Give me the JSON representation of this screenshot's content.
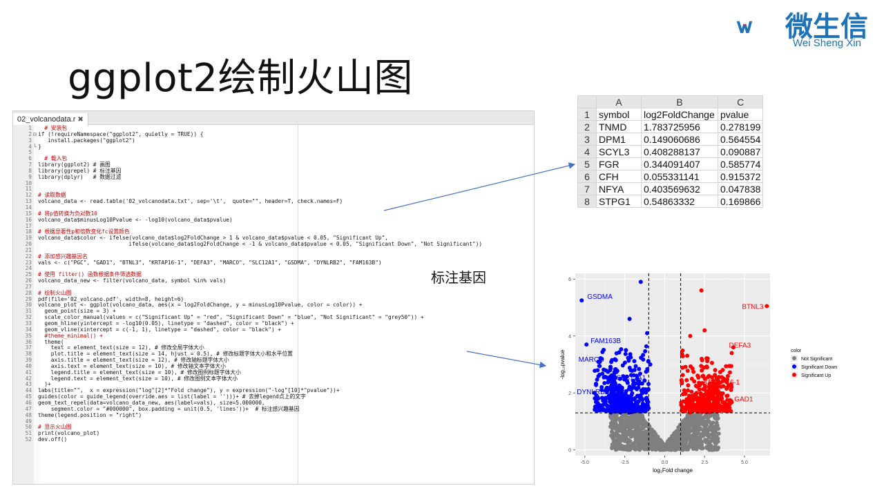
{
  "slide": {
    "title": "ggplot2绘制火山图",
    "annotation": "标注基因"
  },
  "logo": {
    "name": "微生信",
    "subtitle": "Wei Sheng Xin",
    "color": "#1d72b8"
  },
  "editor": {
    "tab_label": "02_volcanodata.r",
    "tab_close": "✖",
    "lines": [
      {
        "n": "1",
        "f": "",
        "t": "  # 安装包",
        "k": "comment"
      },
      {
        "n": "2",
        "f": "⊟",
        "t": "if (!requireNamespace(\"ggplot2\", quietly = TRUE)) {",
        "k": ""
      },
      {
        "n": "3",
        "f": "",
        "t": "   install.packages(\"ggplot2\")",
        "k": ""
      },
      {
        "n": "4",
        "f": "└",
        "t": "}",
        "k": ""
      },
      {
        "n": "5",
        "f": "",
        "t": "",
        "k": ""
      },
      {
        "n": "6",
        "f": "",
        "t": "  # 载入包",
        "k": "comment"
      },
      {
        "n": "7",
        "f": "",
        "t": "library(ggplot2) # 画图",
        "k": ""
      },
      {
        "n": "8",
        "f": "",
        "t": "library(ggrepel) # 标注基因",
        "k": ""
      },
      {
        "n": "9",
        "f": "",
        "t": "library(dplyr)   # 数据过滤",
        "k": ""
      },
      {
        "n": "10",
        "f": "",
        "t": "",
        "k": ""
      },
      {
        "n": "11",
        "f": "",
        "t": "",
        "k": ""
      },
      {
        "n": "12",
        "f": "",
        "t": "# 读取数据",
        "k": "comment"
      },
      {
        "n": "13",
        "f": "",
        "t": "volcano_data <- read.table('02_volcanodata.txt', sep='\\t',  quote=\"\", header=T, check.names=F)",
        "k": ""
      },
      {
        "n": "14",
        "f": "",
        "t": "",
        "k": ""
      },
      {
        "n": "15",
        "f": "",
        "t": "# 将p值转换为负对数10",
        "k": "comment"
      },
      {
        "n": "16",
        "f": "",
        "t": "volcano_data$minusLog10Pvalue <- -log10(volcano_data$pvalue)",
        "k": ""
      },
      {
        "n": "17",
        "f": "",
        "t": "",
        "k": ""
      },
      {
        "n": "18",
        "f": "",
        "t": "# 根据显著性p和倍数变化fc设置颜色",
        "k": "comment"
      },
      {
        "n": "19",
        "f": "",
        "t": "volcano_data$color <- ifelse(volcano_data$log2FoldChange > 1 & volcano_data$pvalue < 0.05, \"Significant Up\",",
        "k": ""
      },
      {
        "n": "20",
        "f": "",
        "t": "                            ifelse(volcano_data$log2FoldChange < -1 & volcano_data$pvalue < 0.05, \"Significant Down\", \"Not Significant\"))",
        "k": ""
      },
      {
        "n": "21",
        "f": "",
        "t": "",
        "k": ""
      },
      {
        "n": "22",
        "f": "",
        "t": "# 添加感兴趣基因名",
        "k": "comment"
      },
      {
        "n": "23",
        "f": "",
        "t": "vals <- c(\"PGC\", \"GAD1\", \"BTNL3\", \"KRTAP16-1\", \"DEFA3\", \"MARCO\", \"SLC12A1\", \"GSDMA\", \"DYNLRB2\", \"FAM163B\")",
        "k": ""
      },
      {
        "n": "24",
        "f": "",
        "t": "",
        "k": ""
      },
      {
        "n": "25",
        "f": "",
        "t": "# 使用 filter() 函数根据条件筛选数据",
        "k": "comment"
      },
      {
        "n": "26",
        "f": "",
        "t": "volcano_data_new <- filter(volcano_data, symbol %in% vals)",
        "k": ""
      },
      {
        "n": "27",
        "f": "",
        "t": "",
        "k": ""
      },
      {
        "n": "28",
        "f": "",
        "t": "# 绘制火山图",
        "k": "comment"
      },
      {
        "n": "29",
        "f": "",
        "t": "pdf(file='02_volcano.pdf', width=8, height=6)",
        "k": ""
      },
      {
        "n": "30",
        "f": "",
        "t": "volcano_plot <- ggplot(volcano_data, aes(x = log2FoldChange, y = minusLog10Pvalue, color = color)) +",
        "k": ""
      },
      {
        "n": "31",
        "f": "",
        "t": "  geom_point(size = 3) +",
        "k": ""
      },
      {
        "n": "32",
        "f": "",
        "t": "  scale_color_manual(values = c(\"Significant Up\" = \"red\", \"Significant Down\" = \"blue\", \"Not Significant\" = \"grey50\")) +",
        "k": ""
      },
      {
        "n": "33",
        "f": "",
        "t": "  geom_hline(yintercept = -log10(0.05), linetype = \"dashed\", color = \"black\") +",
        "k": ""
      },
      {
        "n": "34",
        "f": "",
        "t": "  geom_vline(xintercept = c(-1, 1), linetype = \"dashed\", color = \"black\") +",
        "k": ""
      },
      {
        "n": "35",
        "f": "",
        "t": "  #theme_minimal() +",
        "k": "comment"
      },
      {
        "n": "36",
        "f": "",
        "t": "  theme(",
        "k": ""
      },
      {
        "n": "37",
        "f": "",
        "t": "    text = element_text(size = 12), # 修改全局字体大小",
        "k": ""
      },
      {
        "n": "38",
        "f": "",
        "t": "    plot.title = element_text(size = 14, hjust = 0.5), # 修改标题字体大小和水平位置",
        "k": ""
      },
      {
        "n": "39",
        "f": "",
        "t": "    axis.title = element_text(size = 12), # 修改轴标题字体大小",
        "k": ""
      },
      {
        "n": "40",
        "f": "",
        "t": "    axis.text = element_text(size = 10), # 修改轴文本字体大小",
        "k": ""
      },
      {
        "n": "41",
        "f": "",
        "t": "    legend.title = element_text(size = 10), # 修改图例标题字体大小",
        "k": ""
      },
      {
        "n": "42",
        "f": "",
        "t": "    legend.text = element_text(size = 10), # 修改图例文本字体大小",
        "k": ""
      },
      {
        "n": "43",
        "f": "",
        "t": "  )+",
        "k": ""
      },
      {
        "n": "44",
        "f": "",
        "t": "labs(title=\"\",  x = expression(\"log\"[2]*\"Fold change\"), y = expression(\"-log\"[10]*\"pvalue\"))+",
        "k": ""
      },
      {
        "n": "45",
        "f": "",
        "t": "guides(color = guide_legend(override.aes = list(label = '')))+ # 去掉legend点上的文字",
        "k": ""
      },
      {
        "n": "46",
        "f": "",
        "t": "geom_text_repel(data=volcano_data_new, aes(label=vals), size=5.000000,",
        "k": ""
      },
      {
        "n": "47",
        "f": "",
        "t": "    segment.color = \"#000000\", box.padding = unit(0.5, 'lines'))+  # 标注感兴趣基因",
        "k": ""
      },
      {
        "n": "48",
        "f": "",
        "t": "theme(legend.position = \"right\")",
        "k": ""
      },
      {
        "n": "49",
        "f": "",
        "t": "",
        "k": ""
      },
      {
        "n": "50",
        "f": "",
        "t": "# 显示火山图",
        "k": "comment"
      },
      {
        "n": "51",
        "f": "",
        "t": "print(volcano_plot)",
        "k": ""
      },
      {
        "n": "52",
        "f": "",
        "t": "dev.off()",
        "k": ""
      }
    ]
  },
  "spreadsheet": {
    "columns": [
      "A",
      "B",
      "C"
    ],
    "rows": [
      {
        "n": "1",
        "a": "symbol",
        "b": "log2FoldChange",
        "c": "pvalue"
      },
      {
        "n": "2",
        "a": "TNMD",
        "b": "1.783725956",
        "c": "0.278199"
      },
      {
        "n": "3",
        "a": "DPM1",
        "b": "0.149060686",
        "c": "0.564554"
      },
      {
        "n": "4",
        "a": "SCYL3",
        "b": "0.408288137",
        "c": "0.090887"
      },
      {
        "n": "5",
        "a": "FGR",
        "b": "0.344091407",
        "c": "0.585774"
      },
      {
        "n": "6",
        "a": "CFH",
        "b": "0.055331141",
        "c": "0.915372"
      },
      {
        "n": "7",
        "a": "NFYA",
        "b": "0.403569632",
        "c": "0.047838"
      },
      {
        "n": "8",
        "a": "STPG1",
        "b": "0.54863332",
        "c": "0.169866"
      }
    ]
  },
  "chart_data": {
    "type": "scatter",
    "title": "",
    "xlabel": "log₂Fold change",
    "ylabel": "-log₁₀pvalue",
    "xlim": [
      -5.6,
      6.6
    ],
    "ylim": [
      -0.2,
      6.2
    ],
    "xticks": [
      "-5.0",
      "-2.5",
      "0.0",
      "2.5",
      "5.0"
    ],
    "xtick_values": [
      -5,
      -2.5,
      0,
      2.5,
      5
    ],
    "yticks": [
      "0",
      "2",
      "4",
      "6"
    ],
    "ytick_values": [
      0,
      2,
      4,
      6
    ],
    "hline": 1.3,
    "vlines": [
      -1,
      1
    ],
    "grid": true,
    "legend": {
      "title": "color",
      "position": "right",
      "entries": [
        {
          "label": "Not Significant",
          "color": "#7f7f7f"
        },
        {
          "label": "Significant Down",
          "color": "#0000ff"
        },
        {
          "label": "Significant Up",
          "color": "#ff0000"
        }
      ]
    },
    "labeled_points": [
      {
        "label": "BTNL3",
        "x": 6.4,
        "y": 5.05,
        "color": "#ff0000"
      },
      {
        "label": "DEFA3",
        "x": 4.2,
        "y": 3.4,
        "color": "#ff0000"
      },
      {
        "label": "KRTAP16-1",
        "x": 3.3,
        "y": 2.2,
        "color": "#ff0000"
      },
      {
        "label": "GAD1",
        "x": 4.1,
        "y": 1.75,
        "color": "#ff0000"
      },
      {
        "label": "PGC",
        "x": 3.1,
        "y": 1.65,
        "color": "#ff0000"
      },
      {
        "label": "GSDMA",
        "x": -5.2,
        "y": 5.25,
        "color": "#0000ff"
      },
      {
        "label": "FAM163B",
        "x": -4.9,
        "y": 3.7,
        "color": "#0000ff"
      },
      {
        "label": "MARCO",
        "x": -4.1,
        "y": 2.95,
        "color": "#0000ff"
      },
      {
        "label": "SLC12A1",
        "x": -3.2,
        "y": 2.5,
        "color": "#0000ff"
      },
      {
        "label": "DYNLRB2",
        "x": -3.6,
        "y": 2.1,
        "color": "#0000ff"
      }
    ],
    "series": [
      {
        "name": "Not Significant",
        "color": "#7f7f7f",
        "points_estimated": "dense V-shaped cloud, x within ±3.5, y 0–2.6"
      },
      {
        "name": "Significant Down",
        "color": "#0000ff",
        "points_estimated": "x -4.8 to -1, y 1.3–4.0, outliers up to 5.9"
      },
      {
        "name": "Significant Up",
        "color": "#ff0000",
        "points_estimated": "x 1 to 4.5, y 1.3–3.8, outliers up to 5.6"
      }
    ]
  }
}
